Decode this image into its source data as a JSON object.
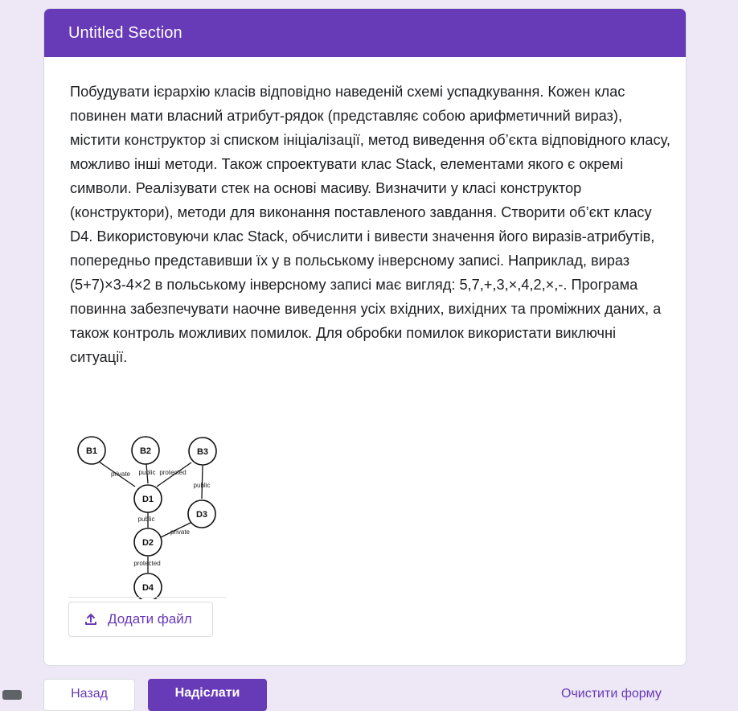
{
  "section": {
    "title": "Untitled Section",
    "description": "Побудувати ієрархію класів відповідно наведеній схемі успадкування. Кожен клас повинен мати власний атрибут-рядок (представляє собою арифметичний вираз), містити конструктор зі списком ініціалізації, метод виведення об’єкта відповідного класу, можливо інші методи. Також спроектувати клас Stack, елементами якого є окремі символи. Реалізувати стек на основі масиву. Визначити у класі конструктор (конструктори), методи для виконання поставленого завдання. Створити об’єкт класу D4. Використовуючи клас Stack, обчислити і вивести значення його виразів-атрибутів, попередньо представивши їх у в польському інверсному записі. Наприклад, вираз (5+7)×3-4×2 в польському інверсному записі має вигляд: 5,7,+,3,×,4,2,×,-. Програма повинна забезпечувати наочне виведення усіх вхідних, вихідних та проміжних даних, а також контроль можливих помилок. Для обробки помилок використати виключні ситуації."
  },
  "diagram": {
    "nodes": {
      "b1": "B1",
      "b2": "B2",
      "b3": "B3",
      "d1": "D1",
      "d2": "D2",
      "d3": "D3",
      "d4": "D4"
    },
    "edges": {
      "b1_d1": "private",
      "b2_d1": "public",
      "b3_d1": "protected",
      "b3_d3": "public",
      "d1_d2": "public",
      "d3_d2": "private",
      "d2_d4": "protected"
    }
  },
  "upload": {
    "label": "Додати файл",
    "icon": "upload-icon"
  },
  "footer": {
    "back_label": "Назад",
    "submit_label": "Надіслати",
    "clear_label": "Очистити форму"
  },
  "colors": {
    "accent": "#673ab7",
    "background": "#ede7f6"
  }
}
